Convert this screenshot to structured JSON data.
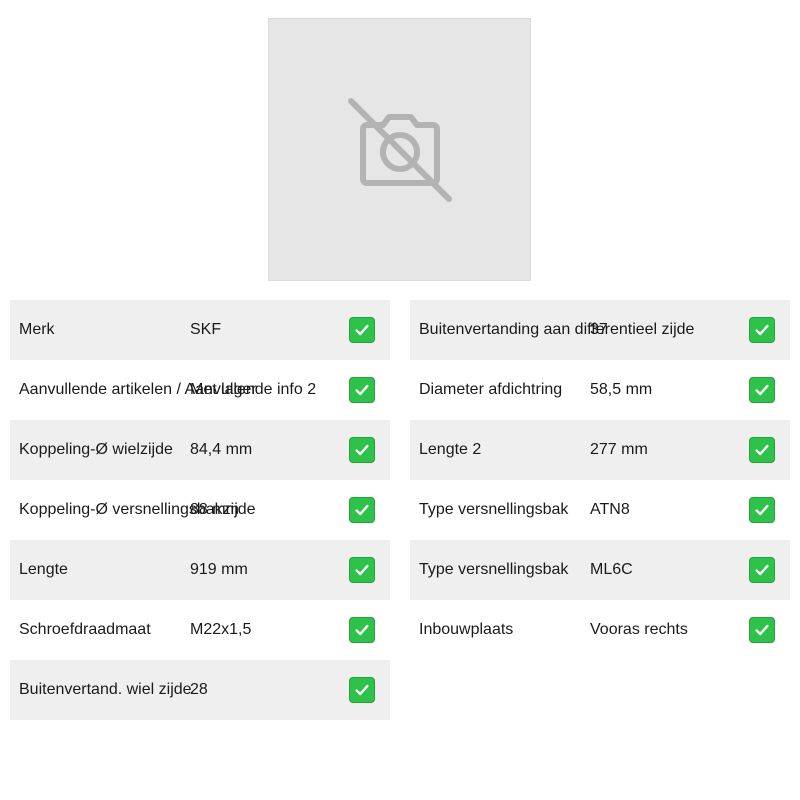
{
  "image": {
    "icon": "no-photo-icon"
  },
  "colors": {
    "check": "#2ec24a",
    "row_shade": "#efefef",
    "placeholder_bg": "#e6e6e6"
  },
  "specs_left": [
    {
      "label": "Merk",
      "value": "SKF"
    },
    {
      "label": "Aanvullende artikelen / Aanvullende info 2",
      "value": "Met lager"
    },
    {
      "label": "Koppeling-Ø wielzijde",
      "value": "84,4 mm"
    },
    {
      "label": "Koppeling-Ø versnellingsbakzijde",
      "value": "88 mm"
    },
    {
      "label": "Lengte",
      "value": "919 mm"
    },
    {
      "label": "Schroefdraadmaat",
      "value": "M22x1,5"
    },
    {
      "label": "Buitenvertand. wiel zijde",
      "value": "28"
    }
  ],
  "specs_right": [
    {
      "label": "Buitenvertanding aan differentieel zijde",
      "value": "37"
    },
    {
      "label": "Diameter afdichtring",
      "value": "58,5 mm"
    },
    {
      "label": "Lengte 2",
      "value": "277 mm"
    },
    {
      "label": "Type versnellingsbak",
      "value": "ATN8"
    },
    {
      "label": "Type versnellingsbak",
      "value": "ML6C"
    },
    {
      "label": "Inbouwplaats",
      "value": "Vooras rechts"
    }
  ]
}
